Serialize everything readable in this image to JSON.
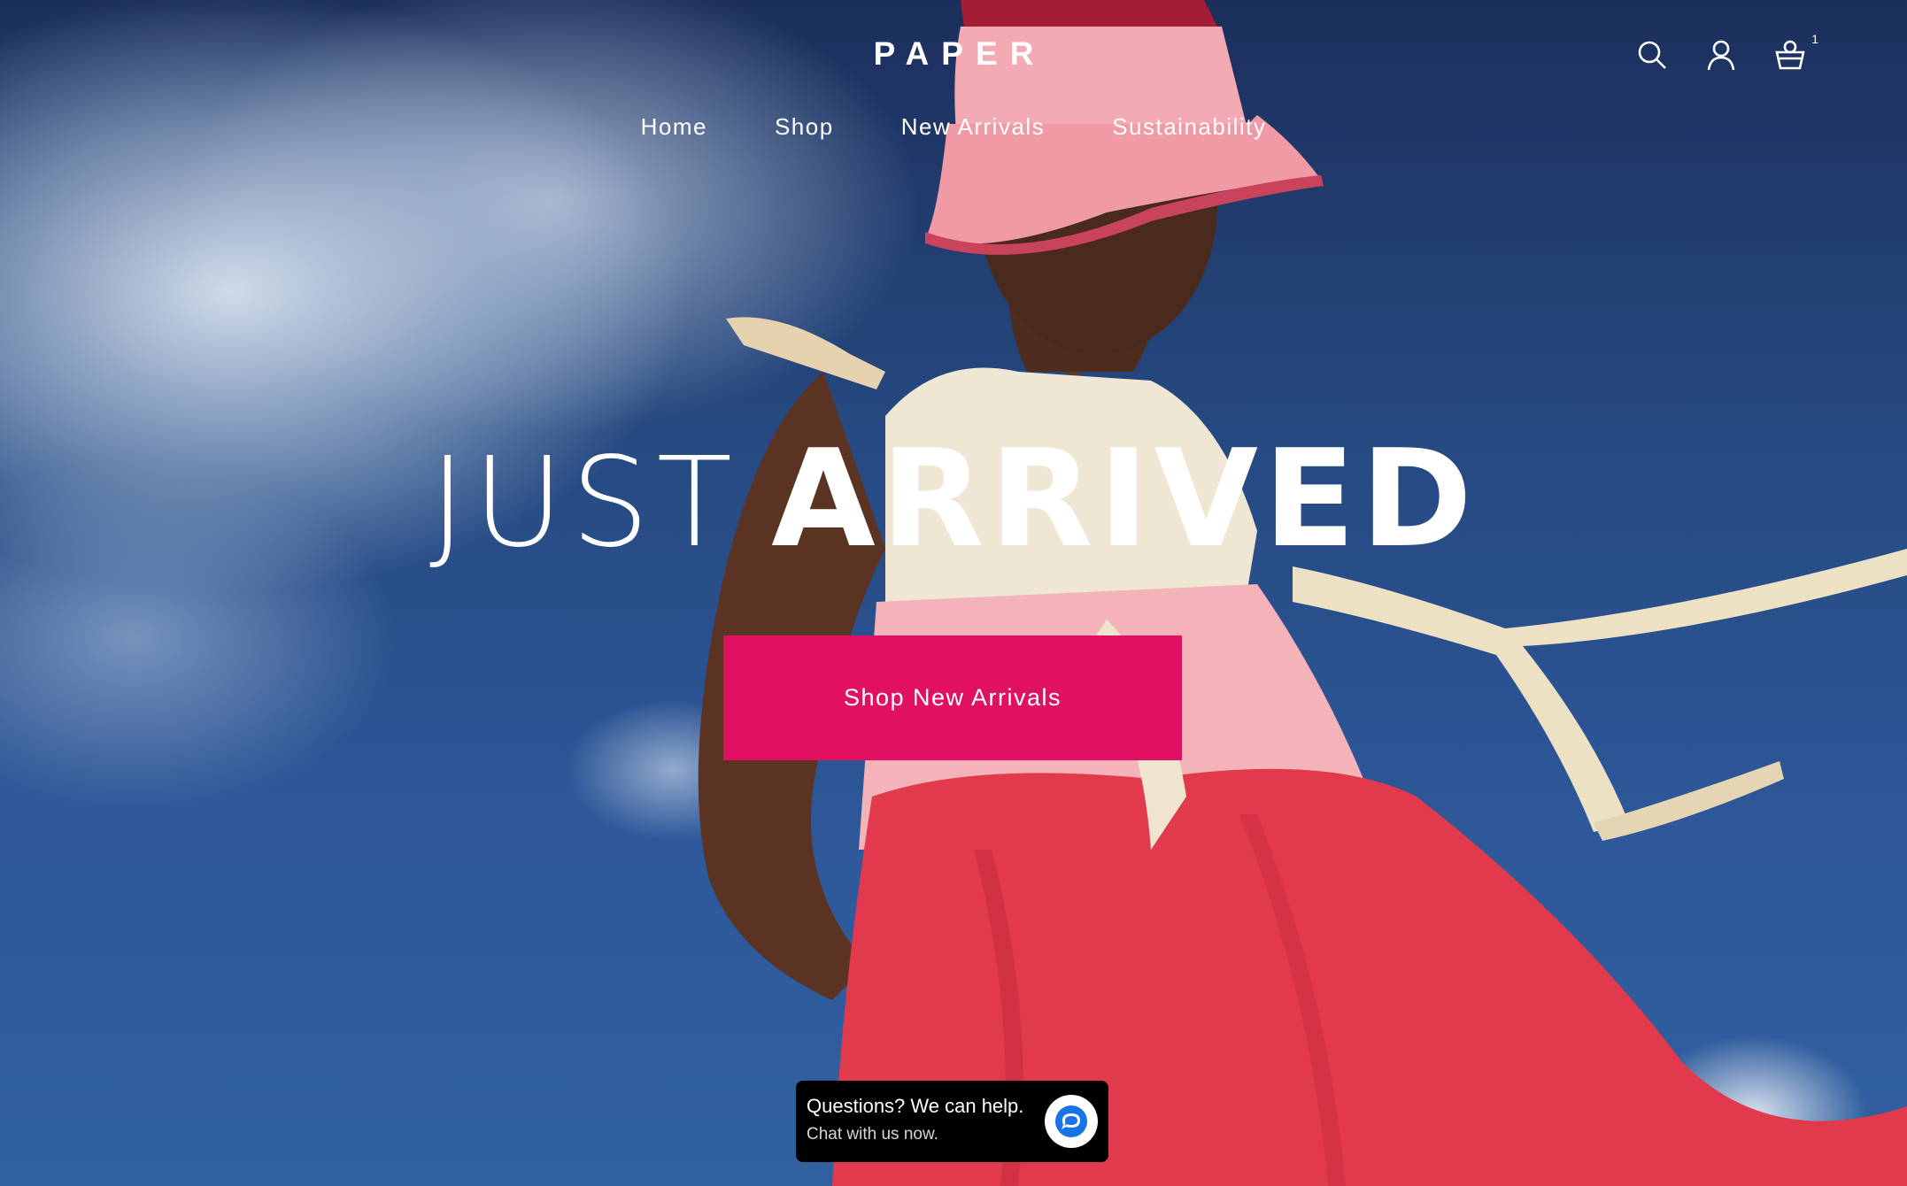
{
  "brand": {
    "logo": "PAPER"
  },
  "nav": {
    "items": [
      "Home",
      "Shop",
      "New Arrivals",
      "Sustainability"
    ]
  },
  "header_icons": {
    "search": "search-icon",
    "account": "user-icon",
    "cart": "basket-icon",
    "cart_count": "1"
  },
  "hero": {
    "headline_light": "JUST",
    "headline_bold": "ARRIVED",
    "cta_label": "Shop New Arrivals"
  },
  "chat": {
    "title": "Questions? We can help.",
    "subtitle": "Chat with us now.",
    "icon": "chat-bubble-icon"
  },
  "colors": {
    "cta": "#e01062",
    "sky": "#2e589a",
    "dress": "#e8404f",
    "hat": "#f2a4ad"
  }
}
